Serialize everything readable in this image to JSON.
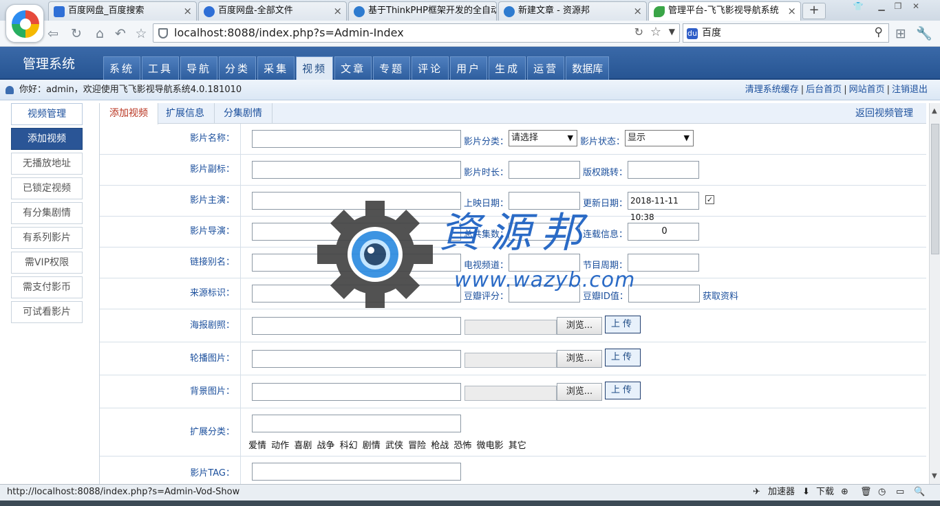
{
  "browser": {
    "tabs": [
      {
        "title": "百度网盘_百度搜索",
        "icon_color": "#2f6fd6"
      },
      {
        "title": "百度网盘-全部文件",
        "icon_color": "#2f6fd6"
      },
      {
        "title": "基于ThinkPHP框架开发的全自动",
        "icon_color": "#2e7bcf"
      },
      {
        "title": "新建文章 - 资源邦",
        "icon_color": "#2e7bcf"
      },
      {
        "title": "管理平台-飞飞影视导航系统",
        "icon_color": "#3aa547"
      }
    ],
    "new_tab": "+",
    "url": "localhost:8088/index.php?s=Admin-Index",
    "search_engine": "百度"
  },
  "header": {
    "system_name": "管理系统",
    "menu": [
      "系统",
      "工具",
      "导航",
      "分类",
      "采集",
      "视频",
      "文章",
      "专题",
      "评论",
      "用户",
      "生成",
      "运营",
      "数据库"
    ],
    "active_menu": "视频"
  },
  "welcome": {
    "text": "你好：admin，欢迎使用飞飞影视导航系统4.0.181010",
    "links": [
      "清理系统缓存",
      "后台首页",
      "网站首页",
      "注销退出"
    ]
  },
  "sidebar": {
    "title": "视频管理",
    "items": [
      "添加视频",
      "无播放地址",
      "已锁定视频",
      "有分集剧情",
      "有系列影片",
      "需VIP权限",
      "需支付影币",
      "可试看影片"
    ],
    "active": "添加视频"
  },
  "subtabs": [
    "添加视频",
    "扩展信息",
    "分集剧情"
  ],
  "back_link": "返回视频管理",
  "form": {
    "name_label": "影片名称：",
    "category_label": "影片分类：",
    "category_value": "请选择",
    "status_label": "影片状态：",
    "status_value": "显示",
    "subtitle_label": "影片副标：",
    "duration_label": "影片时长：",
    "copyright_label": "版权跳转：",
    "actor_label": "影片主演：",
    "release_label": "上映日期：",
    "update_label": "更新日期：",
    "update_value": "2018-11-11 10:38",
    "update_checked": true,
    "director_label": "影片导演：",
    "episodes_label": "总共集数：",
    "serial_label": "连载信息：",
    "serial_value": "0",
    "alias_label": "链接别名：",
    "tvchannel_label": "电视频道：",
    "period_label": "节目周期：",
    "source_label": "来源标识：",
    "douban_score_label": "豆瓣评分：",
    "douban_id_label": "豆瓣ID值：",
    "fetch_link": "获取资料",
    "poster_label": "海报剧照：",
    "carousel_label": "轮播图片：",
    "background_label": "背景图片：",
    "browse_label": "浏览...",
    "upload_label": "上传",
    "ext_category_label": "扩展分类：",
    "genres": [
      "爱情",
      "动作",
      "喜剧",
      "战争",
      "科幻",
      "剧情",
      "武侠",
      "冒险",
      "枪战",
      "恐怖",
      "微电影",
      "其它"
    ],
    "tag_label": "影片TAG："
  },
  "watermark": {
    "cjk": "資源邦",
    "url": "www.wazyb.com"
  },
  "statusbar": {
    "url": "http://localhost:8088/index.php?s=Admin-Vod-Show",
    "accelerator": "加速器",
    "download": "下载"
  }
}
